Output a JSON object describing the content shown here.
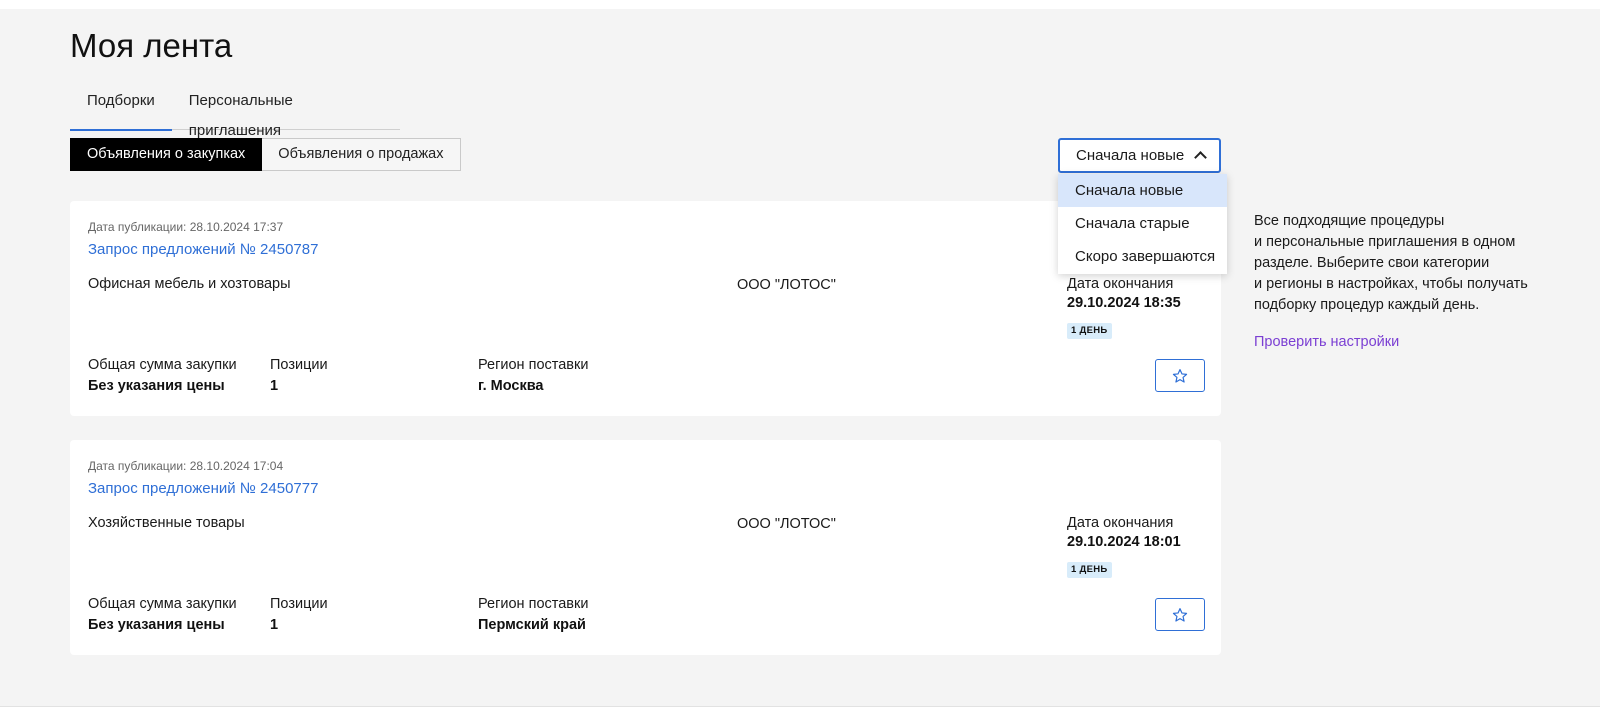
{
  "page": {
    "title": "Моя лента"
  },
  "tabs": [
    {
      "label": "Подборки",
      "active": true
    },
    {
      "label": "Персональные приглашения",
      "active": false
    }
  ],
  "segment": [
    {
      "label": "Объявления о закупках",
      "active": true
    },
    {
      "label": "Объявления о продажах",
      "active": false
    }
  ],
  "sort": {
    "value": "Сначала новые",
    "options": [
      "Сначала новые",
      "Сначала старые",
      "Скоро завершаются"
    ]
  },
  "cards": [
    {
      "pub_date": "Дата публикации: 28.10.2024 17:37",
      "link": "Запрос предложений № 2450787",
      "category": "Офисная мебель и хозтовары",
      "org": "ООО \"ЛОТОС\"",
      "end_label": "Дата окончания",
      "end_value": "29.10.2024 18:35",
      "badge": "1 ДЕНЬ",
      "sum_label": "Общая сумма закупки",
      "sum_value": "Без указания цены",
      "pos_label": "Позиции",
      "pos_value": "1",
      "region_label": "Регион поставки",
      "region_value": "г. Москва"
    },
    {
      "pub_date": "Дата публикации: 28.10.2024 17:04",
      "link": "Запрос предложений № 2450777",
      "category": "Хозяйственные товары",
      "org": "ООО \"ЛОТОС\"",
      "end_label": "Дата окончания",
      "end_value": "29.10.2024 18:01",
      "badge": "1 ДЕНЬ",
      "sum_label": "Общая сумма закупки",
      "sum_value": "Без указания цены",
      "pos_label": "Позиции",
      "pos_value": "1",
      "region_label": "Регион поставки",
      "region_value": "Пермский край"
    }
  ],
  "sidebar": {
    "text_lines": [
      "Все подходящие процедуры",
      "и персональные приглашения в одном",
      "разделе. Выберите свои категории",
      "и регионы в настройках, чтобы получать",
      "подборку процедур каждый день."
    ],
    "link": "Проверить настройки"
  },
  "colors": {
    "accent": "#2f6fd6",
    "link_purple": "#7b3fd3",
    "badge_bg": "#d8ecfa",
    "selected_bg": "#d8e6fb"
  }
}
